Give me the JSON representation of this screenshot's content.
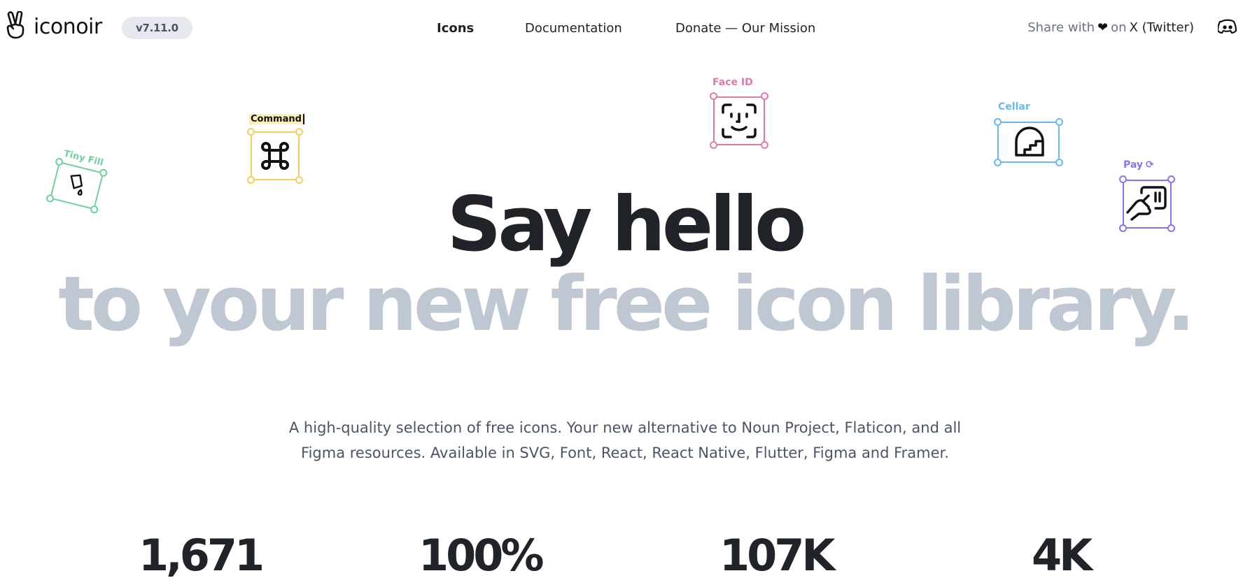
{
  "header": {
    "logo_text": "iconoir",
    "version": "v7.11.0",
    "nav": [
      "Icons",
      "Documentation",
      "Donate — Our Mission"
    ],
    "share_prefix": "Share with",
    "share_on": "on",
    "share_target": "X (Twitter)"
  },
  "hero": {
    "line1": "Say hello",
    "line2": "to your new free icon library.",
    "description_line1": "A high-quality selection of free icons. Your new alternative to Noun Project, Flaticon, and all",
    "description_line2": "Figma resources. Available in SVG, Font, React, React Native, Flutter, Figma and Framer."
  },
  "floating_icons": [
    {
      "label": "Tiny Fill",
      "icon": "tiny-fill-icon",
      "color": "#6fd19c"
    },
    {
      "label": "Command",
      "icon": "command-icon",
      "color": "#f5cf5b"
    },
    {
      "label": "Face ID",
      "icon": "face-id-icon",
      "color": "#e27aa8"
    },
    {
      "label": "Cellar",
      "icon": "cellar-icon",
      "color": "#6cb8ee"
    },
    {
      "label": "Pay",
      "icon": "pay-icon",
      "color": "#8b72f0"
    }
  ],
  "stats": [
    "1,671",
    "100%",
    "107K",
    "4K"
  ],
  "colors": {
    "text": "#202328",
    "muted": "#bfc8d2",
    "badge_bg": "#e5e8ec"
  }
}
